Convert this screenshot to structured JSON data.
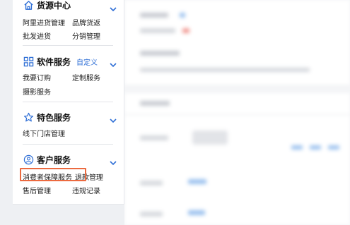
{
  "sidebar": {
    "sections": [
      {
        "title": "货源中心",
        "icon": "home-icon",
        "links": [
          "阿里进货管理",
          "品牌货返",
          "批发进货",
          "分销管理"
        ]
      },
      {
        "title": "软件服务",
        "icon": "grid-icon",
        "extra": "自定义",
        "links": [
          "我要订购",
          "定制服务",
          "摄影服务"
        ]
      },
      {
        "title": "特色服务",
        "icon": "star-icon",
        "links": [
          "线下门店管理"
        ]
      },
      {
        "title": "客户服务",
        "icon": "user-circle-icon",
        "links": [
          "消费者保障服务",
          "退款管理",
          "售后管理",
          "违规记录"
        ]
      }
    ]
  },
  "colors": {
    "accent": "#2f6fd6",
    "highlight": "#ec6a3f"
  }
}
